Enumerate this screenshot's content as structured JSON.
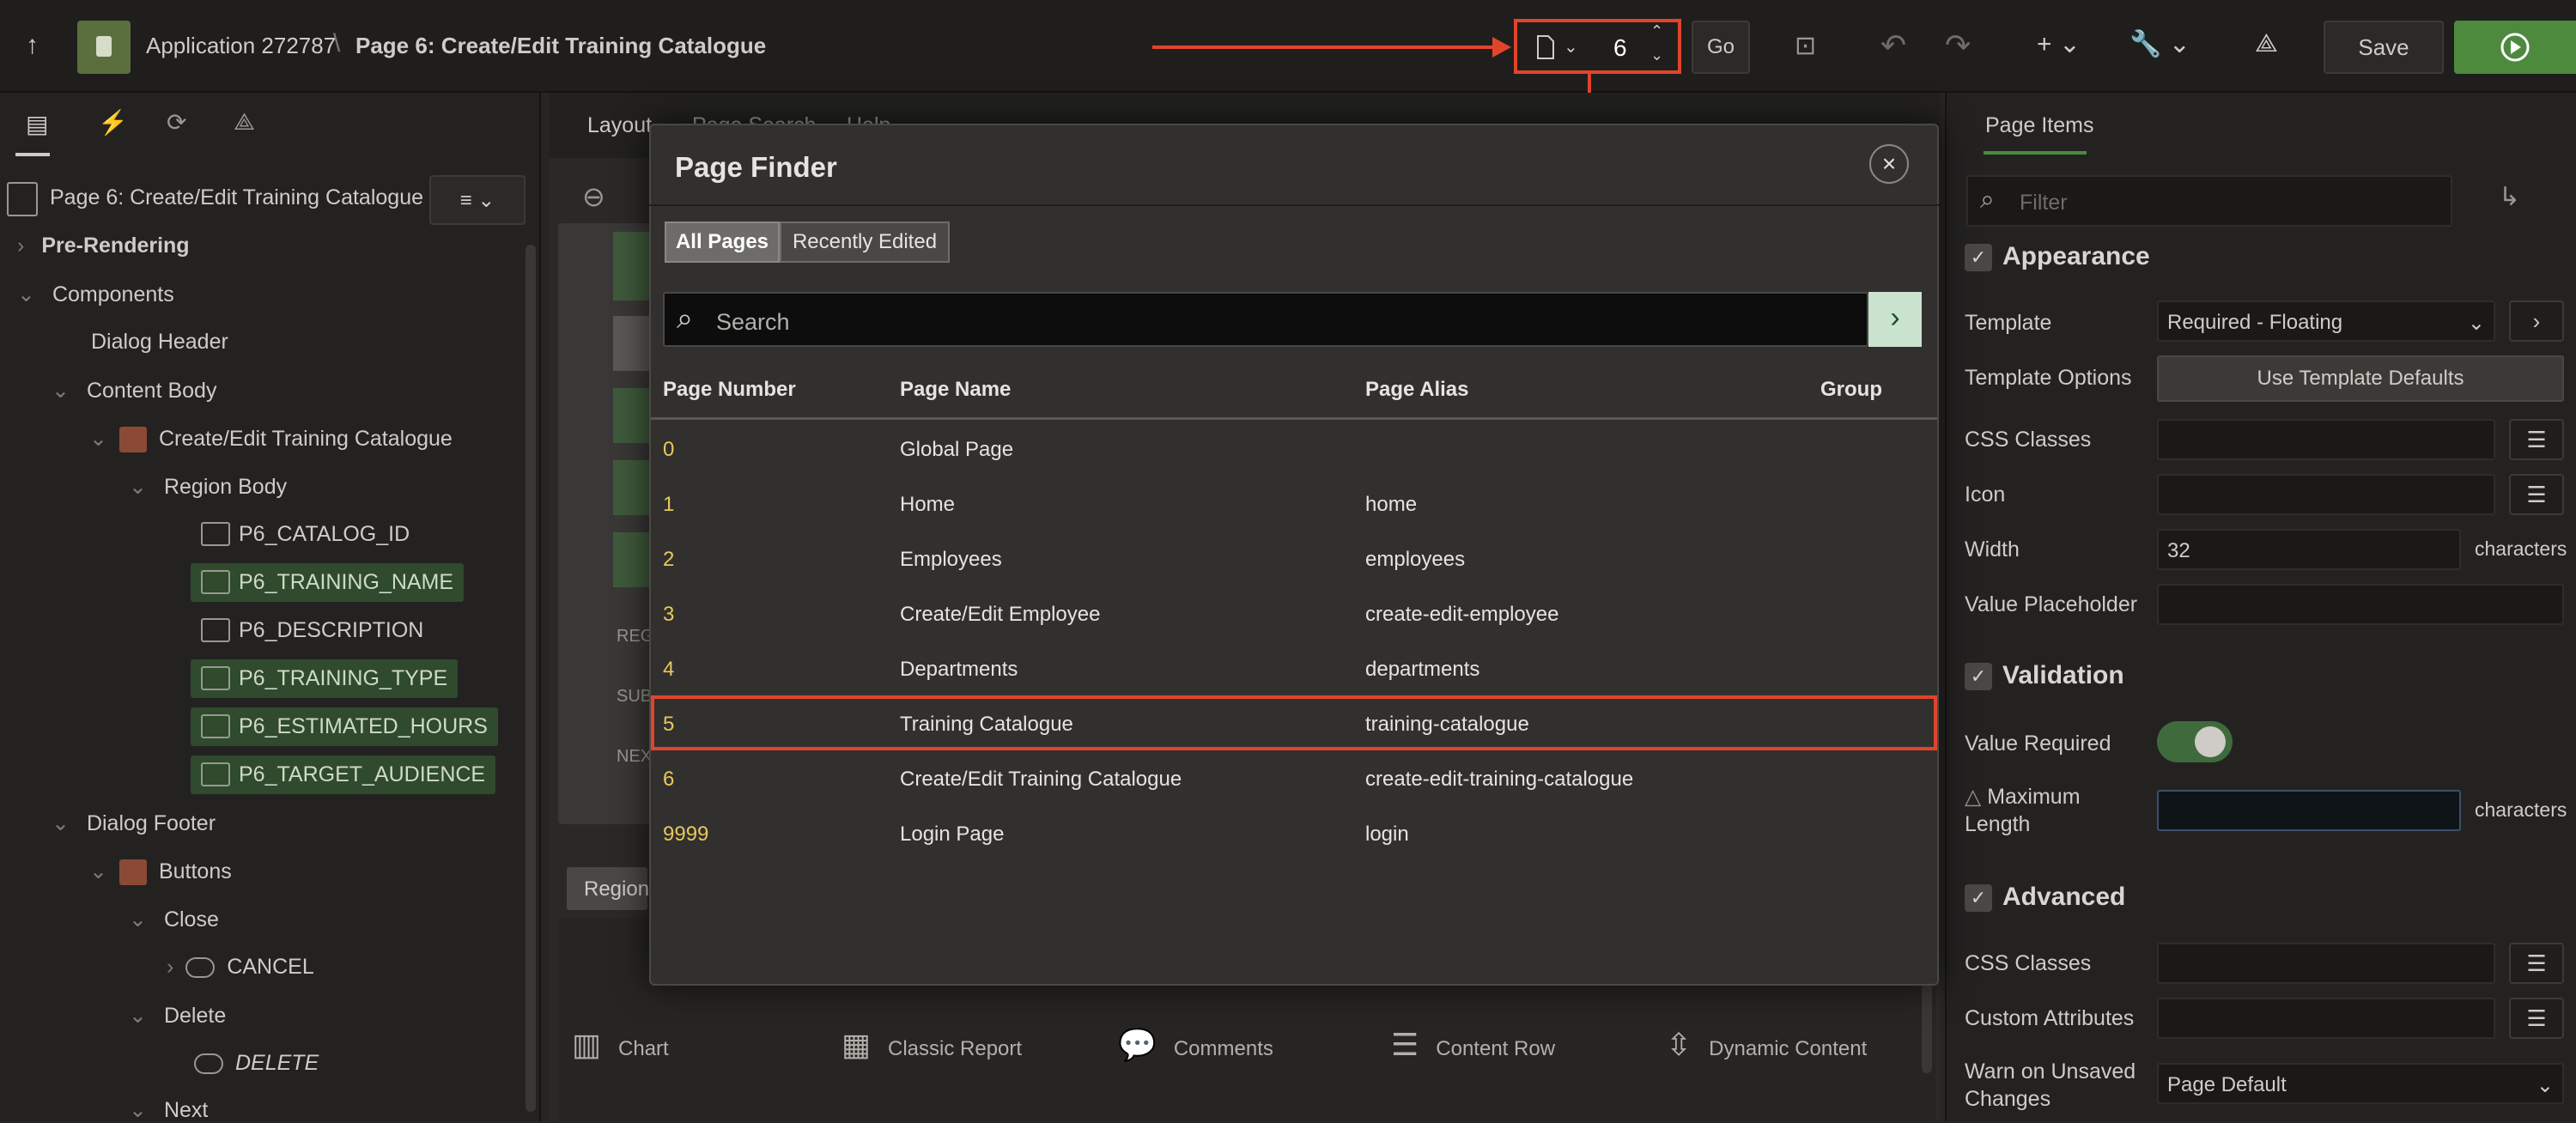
{
  "topbar": {
    "app_title": "Application 272787",
    "page_title": "Page 6: Create/Edit Training Catalogue",
    "page_number": "6",
    "go_label": "Go",
    "save_label": "Save"
  },
  "left_panel": {
    "page_label": "Page 6: Create/Edit Training Catalogue",
    "tree": [
      {
        "label": "Pre-Rendering"
      },
      {
        "label": "Components"
      },
      {
        "label": "Dialog Header"
      },
      {
        "label": "Content Body"
      },
      {
        "label": "Create/Edit Training Catalogue"
      },
      {
        "label": "Region Body"
      },
      {
        "label": "P6_CATALOG_ID"
      },
      {
        "label": "P6_TRAINING_NAME"
      },
      {
        "label": "P6_DESCRIPTION"
      },
      {
        "label": "P6_TRAINING_TYPE"
      },
      {
        "label": "P6_ESTIMATED_HOURS"
      },
      {
        "label": "P6_TARGET_AUDIENCE"
      },
      {
        "label": "Dialog Footer"
      },
      {
        "label": "Buttons"
      },
      {
        "label": "Close"
      },
      {
        "label": "CANCEL"
      },
      {
        "label": "Delete"
      },
      {
        "label": "DELETE"
      },
      {
        "label": "Next"
      }
    ]
  },
  "center": {
    "tab_layout": "Layout",
    "tab_page_search": "Page Search",
    "tab_help": "Help",
    "region_labels": [
      "REG",
      "SUB",
      "NEX"
    ],
    "gallery_tab": "Region",
    "gallery_items": [
      "Chart",
      "Classic Report",
      "Comments",
      "Content Row",
      "Dynamic Content"
    ]
  },
  "modal": {
    "title": "Page Finder",
    "tabs": [
      "All Pages",
      "Recently Edited"
    ],
    "search_placeholder": "Search",
    "columns": [
      "Page Number",
      "Page Name",
      "Page Alias",
      "Group"
    ],
    "rows": [
      {
        "number": "0",
        "name": "Global Page",
        "alias": ""
      },
      {
        "number": "1",
        "name": "Home",
        "alias": "home"
      },
      {
        "number": "2",
        "name": "Employees",
        "alias": "employees"
      },
      {
        "number": "3",
        "name": "Create/Edit Employee",
        "alias": "create-edit-employee"
      },
      {
        "number": "4",
        "name": "Departments",
        "alias": "departments"
      },
      {
        "number": "5",
        "name": "Training Catalogue",
        "alias": "training-catalogue"
      },
      {
        "number": "6",
        "name": "Create/Edit Training Catalogue",
        "alias": "create-edit-training-catalogue"
      },
      {
        "number": "9999",
        "name": "Login Page",
        "alias": "login"
      }
    ]
  },
  "right_panel": {
    "tab": "Page Items",
    "filter_placeholder": "Filter",
    "appearance": "Appearance",
    "template_label": "Template",
    "template_value": "Required - Floating",
    "template_options_label": "Template Options",
    "use_template_defaults": "Use Template Defaults",
    "css_classes_label": "CSS Classes",
    "icon_label": "Icon",
    "width_label": "Width",
    "width_value": "32",
    "characters": "characters",
    "value_placeholder_label": "Value Placeholder",
    "validation": "Validation",
    "value_required_label": "Value Required",
    "maximum_length_label": "Maximum Length",
    "advanced": "Advanced",
    "css_classes_label2": "CSS Classes",
    "custom_attributes_label": "Custom Attributes",
    "warn_unsaved_label": "Warn on Unsaved Changes",
    "warn_unsaved_value": "Page Default"
  },
  "colors": {
    "highlight": "#e0452b",
    "run_button": "#4d8a3e",
    "page_number": "#e6c95a"
  }
}
